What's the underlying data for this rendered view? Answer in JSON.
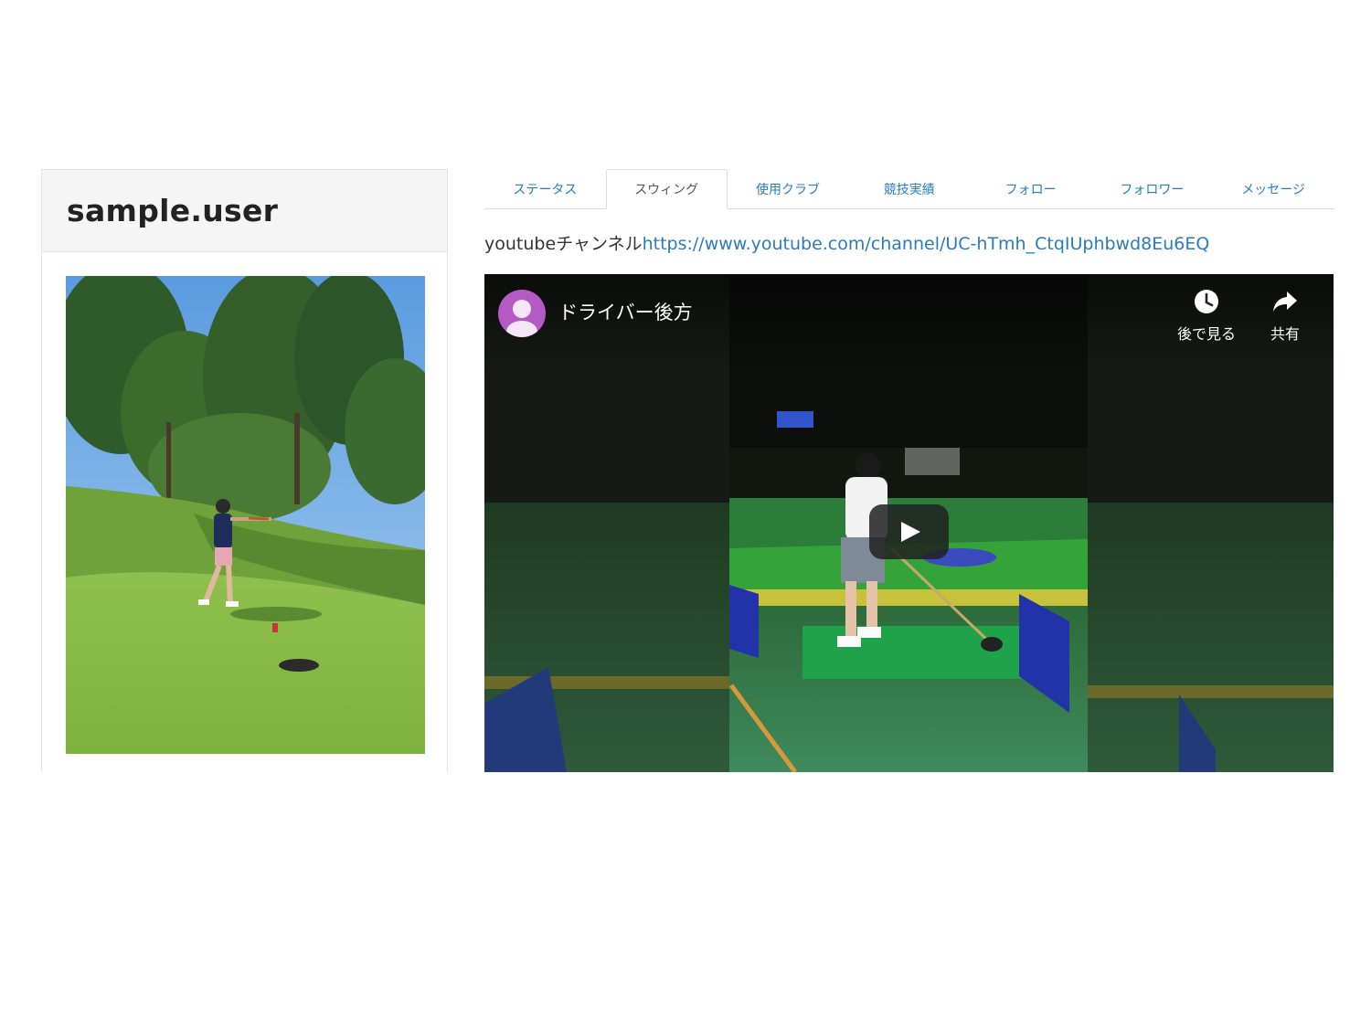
{
  "profile": {
    "username": "sample.user",
    "photo_alt": "golfer"
  },
  "tabs": [
    {
      "label": "ステータス",
      "active": false
    },
    {
      "label": "スウィング",
      "active": true
    },
    {
      "label": "使用クラブ",
      "active": false
    },
    {
      "label": "競技実績",
      "active": false
    },
    {
      "label": "フォロー",
      "active": false
    },
    {
      "label": "フォロワー",
      "active": false
    },
    {
      "label": "メッセージ",
      "active": false
    }
  ],
  "channel": {
    "label": "youtubeチャンネル",
    "url": "https://www.youtube.com/channel/UC-hTmh_CtqIUphbwd8Eu6EQ"
  },
  "video": {
    "title": "ドライバー後方",
    "watch_later_label": "後で見る",
    "share_label": "共有"
  },
  "colors": {
    "link": "#2a7bbd",
    "avatar": "#b55ac4",
    "panel_header_bg": "#f5f5f5"
  }
}
